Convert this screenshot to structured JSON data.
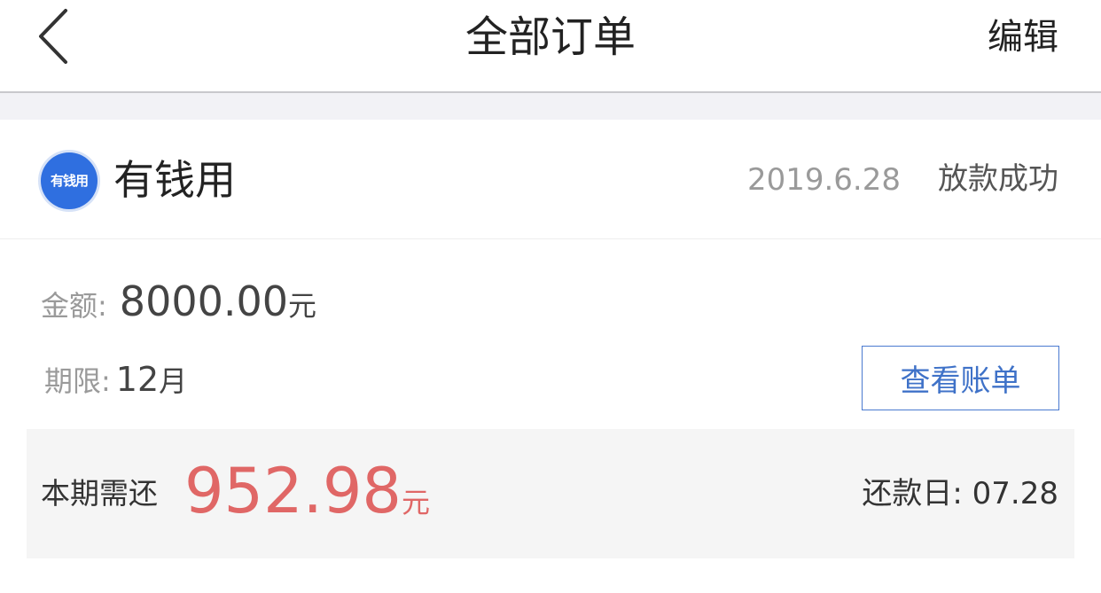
{
  "nav": {
    "title": "全部订单",
    "edit_label": "编辑"
  },
  "order": {
    "app_name": "有钱用",
    "logo_text": "有钱用",
    "date": "2019.6.28",
    "status": "放款成功",
    "amount_label": "金额:",
    "amount_value": "8000.00",
    "amount_unit": "元",
    "term_label": "期限:",
    "term_value": "12",
    "term_unit": "月",
    "view_bill_label": "查看账单",
    "repay_label": "本期需还",
    "repay_amount": "952.98",
    "repay_unit": "元",
    "due_label": "还款日:",
    "due_value": "07.28"
  },
  "colors": {
    "accent_blue": "#3f72c8",
    "repay_red": "#e06766",
    "muted_gray": "#9a9a9a"
  },
  "icons": {
    "back": "chevron-left-icon",
    "logo": "app-logo-icon"
  }
}
